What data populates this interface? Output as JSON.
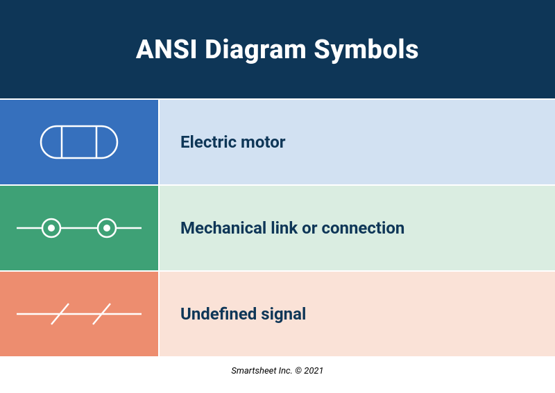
{
  "title": "ANSI Diagram Symbols",
  "rows": [
    {
      "label": "Electric motor"
    },
    {
      "label": "Mechanical link or connection"
    },
    {
      "label": "Undefined signal"
    }
  ],
  "footer": "Smartsheet Inc. © 2021"
}
